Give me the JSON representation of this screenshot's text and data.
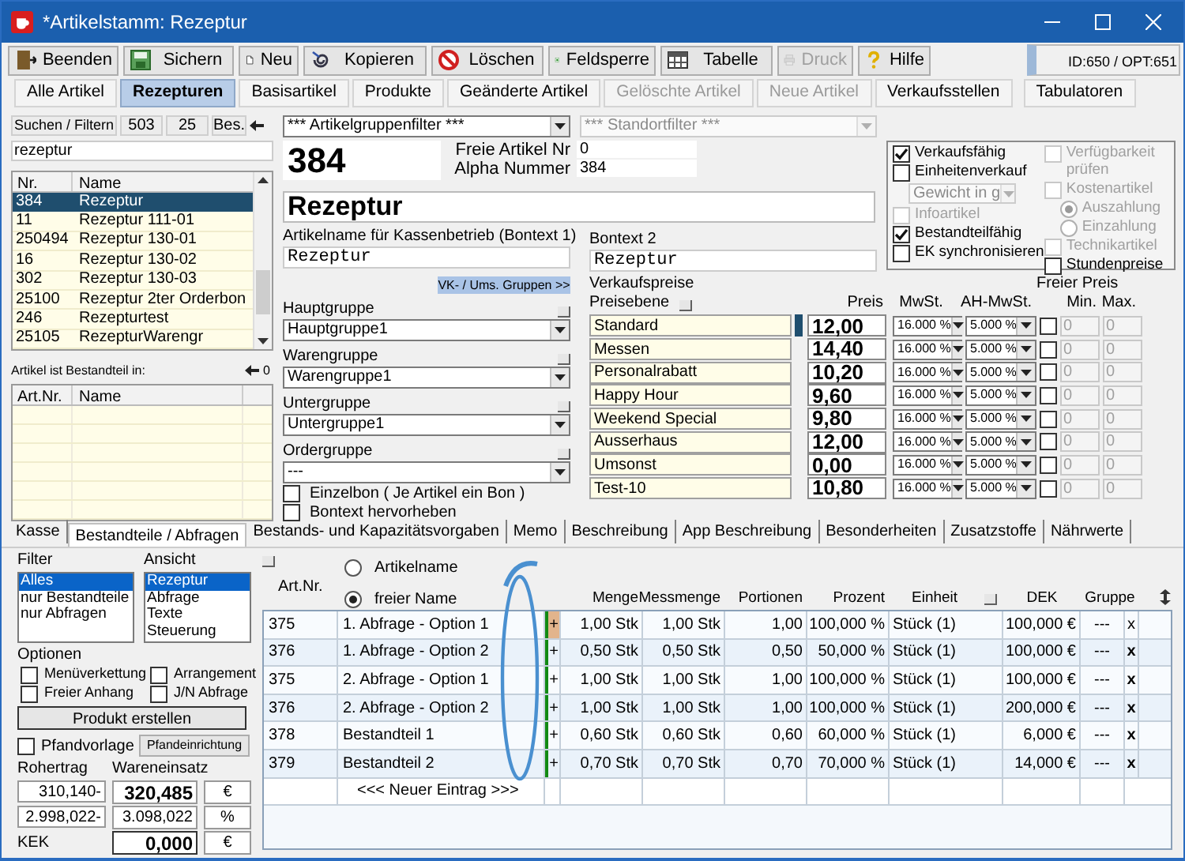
{
  "window": {
    "title": "*Artikelstamm: Rezeptur"
  },
  "toolbar": [
    {
      "label": "Beenden",
      "disabled": false
    },
    {
      "label": "Sichern",
      "disabled": false
    },
    {
      "label": "Neu",
      "disabled": false
    },
    {
      "label": "Kopieren",
      "disabled": false
    },
    {
      "label": "Löschen",
      "disabled": false
    },
    {
      "label": "Feldsperre",
      "disabled": false
    },
    {
      "label": "Tabelle",
      "disabled": false
    },
    {
      "label": "Druck",
      "disabled": true
    },
    {
      "label": "Hilfe",
      "disabled": false
    }
  ],
  "id_info": "ID:650 / OPT:651",
  "tabs": [
    {
      "label": "Alle Artikel",
      "selected": false,
      "disabled": false
    },
    {
      "label": "Rezepturen",
      "selected": true,
      "disabled": false
    },
    {
      "label": "Basisartikel",
      "selected": false,
      "disabled": false
    },
    {
      "label": "Produkte",
      "selected": false,
      "disabled": false
    },
    {
      "label": "Geänderte Artikel",
      "selected": false,
      "disabled": false
    },
    {
      "label": "Gelöschte Artikel",
      "selected": false,
      "disabled": true
    },
    {
      "label": "Neue Artikel",
      "selected": false,
      "disabled": true
    },
    {
      "label": "Verkaufsstellen",
      "selected": false,
      "disabled": false
    },
    {
      "label": "Tabulatoren",
      "selected": false,
      "disabled": false
    }
  ],
  "search": {
    "label": "Suchen / Filtern",
    "count_total": "503",
    "count_found": "25",
    "button": "Bes.",
    "value": "rezeptur"
  },
  "article_list": {
    "columns": [
      "Nr.",
      "Name"
    ],
    "rows": [
      {
        "nr": "384",
        "name": "Rezeptur",
        "selected": true
      },
      {
        "nr": "11",
        "name": "Rezeptur 111-01",
        "selected": false
      },
      {
        "nr": "250494",
        "name": "Rezeptur 130-01",
        "selected": false
      },
      {
        "nr": "16",
        "name": "Rezeptur 130-02",
        "selected": false
      },
      {
        "nr": "302",
        "name": "Rezeptur 130-03",
        "selected": false
      },
      {
        "nr": "25100",
        "name": "Rezeptur 2ter Orderbon",
        "selected": false
      },
      {
        "nr": "246",
        "name": "Rezepturtest",
        "selected": false
      },
      {
        "nr": "25105",
        "name": "RezepturWarengr",
        "selected": false
      }
    ]
  },
  "part_of": {
    "label": "Artikel ist Bestandteil in:",
    "count": "0",
    "columns": [
      "Art.Nr.",
      "Name"
    ]
  },
  "group_filter": "*** Artikelgruppenfilter ***",
  "location_filter": {
    "value": "*** Standortfilter ***",
    "disabled": true
  },
  "article_number": "384",
  "free_number": {
    "label": "Freie Artikel Nr",
    "value": "0"
  },
  "alpha_number": {
    "label": "Alpha Nummer",
    "value": "384"
  },
  "article_name": "Rezeptur",
  "bontext1": {
    "label": "Artikelname für Kassenbetrieb (Bontext 1)",
    "value": "Rezeptur"
  },
  "bontext2": {
    "label": "Bontext 2",
    "value": "Rezeptur"
  },
  "flags_left": [
    {
      "kind": "checkbox",
      "label": "Verkaufsfähig",
      "checked": true,
      "disabled": false
    },
    {
      "kind": "checkbox",
      "label": "Einheitenverkauf",
      "checked": false,
      "disabled": false
    },
    {
      "kind": "select",
      "value": "Gewicht in g",
      "disabled": true
    },
    {
      "kind": "checkbox",
      "label": "Infoartikel",
      "checked": false,
      "disabled": true
    },
    {
      "kind": "checkbox",
      "label": "Bestandteilfähig",
      "checked": true,
      "disabled": false
    },
    {
      "kind": "checkbox",
      "label": "EK synchronisieren",
      "checked": false,
      "disabled": false
    }
  ],
  "flags_right": [
    {
      "kind": "checkbox",
      "label": "Verfügbarkeit prüfen",
      "checked": false,
      "disabled": true
    },
    {
      "kind": "checkbox",
      "label": "Kostenartikel",
      "checked": false,
      "disabled": true
    },
    {
      "kind": "radio",
      "label": "Auszahlung",
      "selected": true,
      "disabled": true
    },
    {
      "kind": "radio",
      "label": "Einzahlung",
      "selected": false,
      "disabled": true
    },
    {
      "kind": "checkbox",
      "label": "Technikartikel",
      "checked": false,
      "disabled": true
    },
    {
      "kind": "checkbox",
      "label": "Stundenpreise",
      "checked": false,
      "disabled": false
    }
  ],
  "vk_button": "VK- / Ums. Gruppen >>",
  "groups": [
    {
      "label": "Hauptgruppe",
      "value": "Hauptgruppe1"
    },
    {
      "label": "Warengruppe",
      "value": "Warengruppe1"
    },
    {
      "label": "Untergruppe",
      "value": "Untergruppe1"
    },
    {
      "label": "Ordergruppe",
      "value": "---"
    }
  ],
  "group_options": [
    {
      "label": "Einzelbon ( Je Artikel ein Bon )",
      "checked": false
    },
    {
      "label": "Bontext hervorheben",
      "checked": false
    }
  ],
  "prices": {
    "title": "Verkaufspreise",
    "level_header": "Preisebene",
    "price_header": "Preis",
    "vat_header": "MwSt.",
    "ah_vat_header": "AH-MwSt.",
    "free_header": "Freier Preis",
    "min_header": "Min.",
    "max_header": "Max.",
    "rows": [
      {
        "name": "Standard",
        "price": "12,00",
        "vat": "16.000 %",
        "ah_vat": "5.000 %",
        "free": false,
        "min": "0",
        "max": "0",
        "selected": true
      },
      {
        "name": "Messen",
        "price": "14,40",
        "vat": "16.000 %",
        "ah_vat": "5.000 %",
        "free": false,
        "min": "0",
        "max": "0",
        "selected": false
      },
      {
        "name": "Personalrabatt",
        "price": "10,20",
        "vat": "16.000 %",
        "ah_vat": "5.000 %",
        "free": false,
        "min": "0",
        "max": "0",
        "selected": false
      },
      {
        "name": "Happy Hour",
        "price": "9,60",
        "vat": "16.000 %",
        "ah_vat": "5.000 %",
        "free": false,
        "min": "0",
        "max": "0",
        "selected": false
      },
      {
        "name": "Weekend Special",
        "price": "9,80",
        "vat": "16.000 %",
        "ah_vat": "5.000 %",
        "free": false,
        "min": "0",
        "max": "0",
        "selected": false
      },
      {
        "name": "Ausserhaus",
        "price": "12,00",
        "vat": "16.000 %",
        "ah_vat": "5.000 %",
        "free": false,
        "min": "0",
        "max": "0",
        "selected": false
      },
      {
        "name": "Umsonst",
        "price": "0,00",
        "vat": "16.000 %",
        "ah_vat": "5.000 %",
        "free": false,
        "min": "0",
        "max": "0",
        "selected": false
      },
      {
        "name": "Test-10",
        "price": "10,80",
        "vat": "16.000 %",
        "ah_vat": "5.000 %",
        "free": false,
        "min": "0",
        "max": "0",
        "selected": false
      }
    ]
  },
  "lower_tabs": [
    {
      "label": "Kasse",
      "selected": false
    },
    {
      "label": "Bestandteile / Abfragen",
      "selected": true
    },
    {
      "label": "Bestands- und Kapazitätsvorgaben",
      "selected": false
    },
    {
      "label": "Memo",
      "selected": false
    },
    {
      "label": "Beschreibung",
      "selected": false
    },
    {
      "label": "App Beschreibung",
      "selected": false
    },
    {
      "label": "Besonderheiten",
      "selected": false
    },
    {
      "label": "Zusatzstoffe",
      "selected": false
    },
    {
      "label": "Nährwerte",
      "selected": false
    }
  ],
  "filter": {
    "label": "Filter",
    "items": [
      {
        "label": "Alles",
        "selected": true
      },
      {
        "label": "nur Bestandteile",
        "selected": false
      },
      {
        "label": "nur Abfragen",
        "selected": false
      }
    ]
  },
  "view": {
    "label": "Ansicht",
    "items": [
      {
        "label": "Rezeptur",
        "selected": true
      },
      {
        "label": "Abfrage",
        "selected": false
      },
      {
        "label": "Texte",
        "selected": false
      },
      {
        "label": "Steuerung",
        "selected": false
      }
    ]
  },
  "options": {
    "label": "Optionen",
    "items": [
      {
        "label": "Menüverkettung",
        "checked": false
      },
      {
        "label": "Arrangement",
        "checked": false
      },
      {
        "label": "Freier Anhang",
        "checked": false
      },
      {
        "label": "J/N Abfrage",
        "checked": false
      }
    ]
  },
  "create_button": "Produkt erstellen",
  "deposit": {
    "label": "Pfandvorlage",
    "checked": false,
    "button": "Pfandeinrichtung"
  },
  "totals": {
    "headers": [
      "Rohertrag",
      "Wareneinsatz"
    ],
    "rows": [
      {
        "rohertrag": "310,140-",
        "wareneinsatz": "320,485",
        "unit": "€",
        "bold": true
      },
      {
        "rohertrag": "2.998,022-",
        "wareneinsatz": "3.098,022",
        "unit": "%",
        "bold": false
      }
    ],
    "kek": {
      "label": "KEK",
      "value": "0,000",
      "unit": "€"
    }
  },
  "name_mode": {
    "label": "Art.Nr.",
    "options": [
      {
        "label": "Artikelname",
        "selected": false
      },
      {
        "label": "freier Name",
        "selected": true
      }
    ]
  },
  "components": {
    "columns": [
      "Menge",
      "Messmenge",
      "Portionen",
      "Prozent",
      "Einheit",
      "DEK",
      "Gruppe"
    ],
    "rows": [
      {
        "art_nr": "375",
        "name": "1. Abfrage - Option 1",
        "plus": "+",
        "menge": "1,00 Stk",
        "messmenge": "1,00 Stk",
        "portionen": "1,00",
        "prozent": "100,000 %",
        "einheit": "Stück (1)",
        "dek": "100,000 €",
        "gruppe": "---",
        "delete": "x",
        "selected": true
      },
      {
        "art_nr": "376",
        "name": "1. Abfrage - Option 2",
        "plus": "+",
        "menge": "0,50 Stk",
        "messmenge": "0,50 Stk",
        "portionen": "0,50",
        "prozent": "50,000 %",
        "einheit": "Stück (1)",
        "dek": "100,000 €",
        "gruppe": "---",
        "delete": "x",
        "selected": false
      },
      {
        "art_nr": "375",
        "name": "2. Abfrage - Option 1",
        "plus": "+",
        "menge": "1,00 Stk",
        "messmenge": "1,00 Stk",
        "portionen": "1,00",
        "prozent": "100,000 %",
        "einheit": "Stück (1)",
        "dek": "100,000 €",
        "gruppe": "---",
        "delete": "x",
        "selected": false
      },
      {
        "art_nr": "376",
        "name": "2. Abfrage - Option 2",
        "plus": "+",
        "menge": "1,00 Stk",
        "messmenge": "1,00 Stk",
        "portionen": "1,00",
        "prozent": "100,000 %",
        "einheit": "Stück (1)",
        "dek": "200,000 €",
        "gruppe": "---",
        "delete": "x",
        "selected": false
      },
      {
        "art_nr": "378",
        "name": "Bestandteil 1",
        "plus": "+",
        "menge": "0,60 Stk",
        "messmenge": "0,60 Stk",
        "portionen": "0,60",
        "prozent": "60,000 %",
        "einheit": "Stück (1)",
        "dek": "6,000 €",
        "gruppe": "---",
        "delete": "x",
        "selected": false
      },
      {
        "art_nr": "379",
        "name": "Bestandteil 2",
        "plus": "+",
        "menge": "0,70 Stk",
        "messmenge": "0,70 Stk",
        "portionen": "0,70",
        "prozent": "70,000 %",
        "einheit": "Stück (1)",
        "dek": "14,000 €",
        "gruppe": "---",
        "delete": "x",
        "selected": false
      }
    ],
    "new_entry": "<<< Neuer Eintrag >>>"
  }
}
